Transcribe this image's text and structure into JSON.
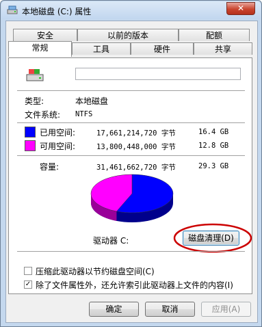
{
  "window": {
    "title": "本地磁盘 (C:) 属性",
    "close_glyph": "✕"
  },
  "tabs": {
    "row1": [
      "安全",
      "以前的版本",
      "配额"
    ],
    "row2": [
      "常规",
      "工具",
      "硬件",
      "共享"
    ],
    "active": "常规"
  },
  "general": {
    "volume_name": "",
    "type_label": "类型:",
    "type_value": "本地磁盘",
    "fs_label": "文件系统:",
    "fs_value": "NTFS",
    "used": {
      "label": "已用空间:",
      "bytes": "17,661,214,720 字节",
      "size": "16.4 GB",
      "color": "#0000ff"
    },
    "free": {
      "label": "可用空间:",
      "bytes": "13,800,448,000 字节",
      "size": "12.8 GB",
      "color": "#ff00ff"
    },
    "capacity": {
      "label": "容量:",
      "bytes": "31,461,662,720 字节",
      "size": "29.3 GB"
    },
    "drive_label": "驱动器 C:",
    "cleanup_button": "磁盘清理(D)",
    "compress_option": {
      "label": "压缩此驱动器以节约磁盘空间(C)",
      "checked": false
    },
    "index_option": {
      "label": "除了文件属性外，还允许索引此驱动器上文件的内容(I)",
      "checked": true
    }
  },
  "chart_data": {
    "type": "pie",
    "categories": [
      "已用空间",
      "可用空间"
    ],
    "values": [
      17661214720,
      13800448000
    ],
    "colors": [
      "#0000ff",
      "#ff00ff"
    ]
  },
  "buttons": {
    "ok": "确定",
    "cancel": "取消",
    "apply": "应用(A)"
  },
  "annotation": {
    "color": "#cc0000"
  }
}
